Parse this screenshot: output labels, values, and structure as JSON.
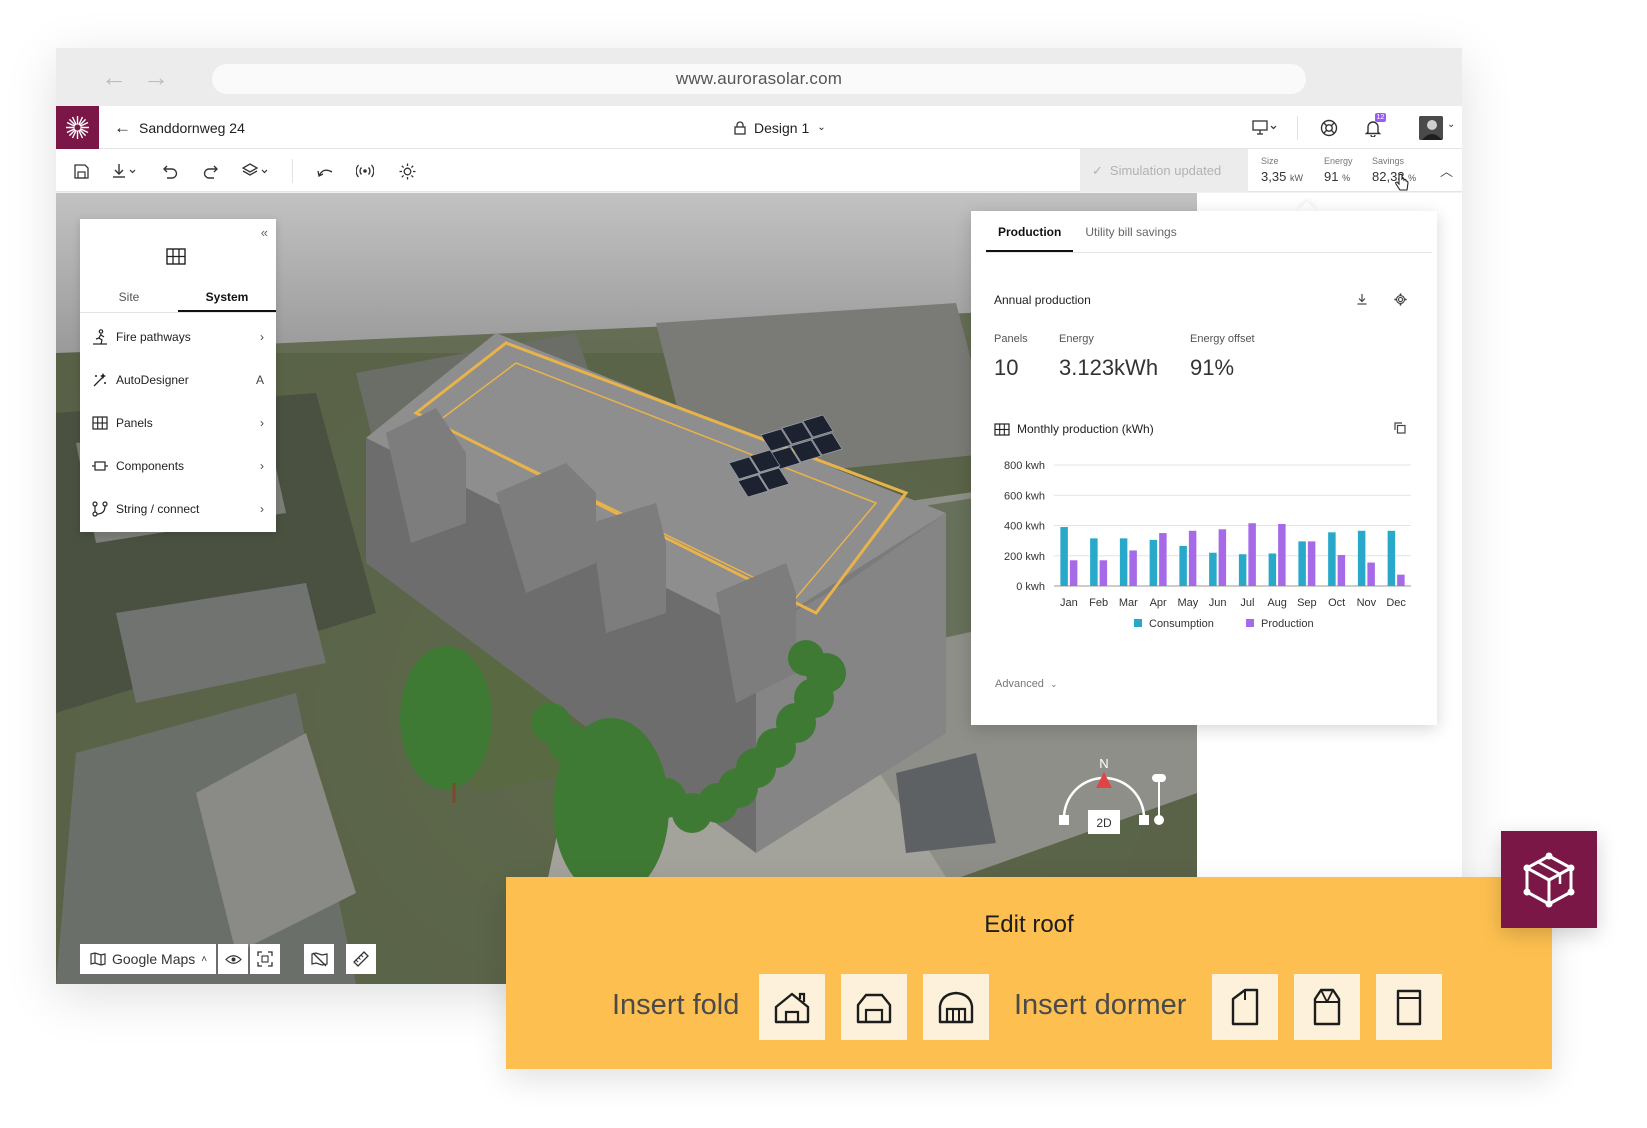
{
  "browser": {
    "url": "www.aurorasolar.com"
  },
  "header": {
    "project_name": "Sanddornweg 24",
    "design_name": "Design 1",
    "notification_count": "12",
    "brand_color": "#7a1746"
  },
  "toolbar": {
    "simulation_status": "Simulation updated",
    "metrics": [
      {
        "label": "Size",
        "value": "3,35",
        "unit": "kW"
      },
      {
        "label": "Energy",
        "value": "91",
        "unit": "%"
      },
      {
        "label": "Savings",
        "value": "82,33",
        "unit": "%"
      }
    ]
  },
  "left_panel": {
    "tabs": [
      "Site",
      "System"
    ],
    "active_tab": "System",
    "items": [
      {
        "label": "Fire pathways",
        "trail": "chevron-right",
        "icon": "fire-pathways-icon"
      },
      {
        "label": "AutoDesigner",
        "trail": "A",
        "icon": "autodesigner-icon"
      },
      {
        "label": "Panels",
        "trail": "chevron-right",
        "icon": "panels-icon"
      },
      {
        "label": "Components",
        "trail": "chevron-right",
        "icon": "components-icon"
      },
      {
        "label": "String / connect",
        "trail": "chevron-right",
        "icon": "string-icon"
      }
    ]
  },
  "production": {
    "tabs": [
      "Production",
      "Utility bill savings"
    ],
    "active_tab": "Production",
    "heading": "Annual production",
    "stats": [
      {
        "label": "Panels",
        "value": "10"
      },
      {
        "label": "Energy",
        "value": "3.123kWh"
      },
      {
        "label": "Energy offset",
        "value": "91%"
      }
    ],
    "chart_title": "Monthly production (kWh)",
    "advanced_label": "Advanced"
  },
  "chart_data": {
    "type": "bar",
    "title": "Monthly production (kWh)",
    "categories": [
      "Jan",
      "Feb",
      "Mar",
      "Apr",
      "May",
      "Jun",
      "Jul",
      "Aug",
      "Sep",
      "Oct",
      "Nov",
      "Dec"
    ],
    "y_ticks": [
      "800 kwh",
      "600 kwh",
      "400 kwh",
      "200 kwh",
      "0 kwh"
    ],
    "ylim": [
      0,
      800
    ],
    "grid": true,
    "legend_position": "bottom",
    "series": [
      {
        "name": "Consumption",
        "color": "#29a9c9",
        "values": [
          390,
          315,
          315,
          305,
          265,
          220,
          210,
          215,
          295,
          355,
          365,
          365
        ]
      },
      {
        "name": "Production",
        "color": "#a66ae8",
        "values": [
          170,
          170,
          235,
          350,
          365,
          375,
          415,
          410,
          295,
          205,
          155,
          75
        ]
      }
    ]
  },
  "map": {
    "source": "Google Maps",
    "compass_north": "N",
    "view_mode": "2D"
  },
  "edit_roof": {
    "title": "Edit roof",
    "insert_fold_label": "Insert fold",
    "insert_dormer_label": "Insert dormer",
    "panel_color": "#fdc050"
  }
}
